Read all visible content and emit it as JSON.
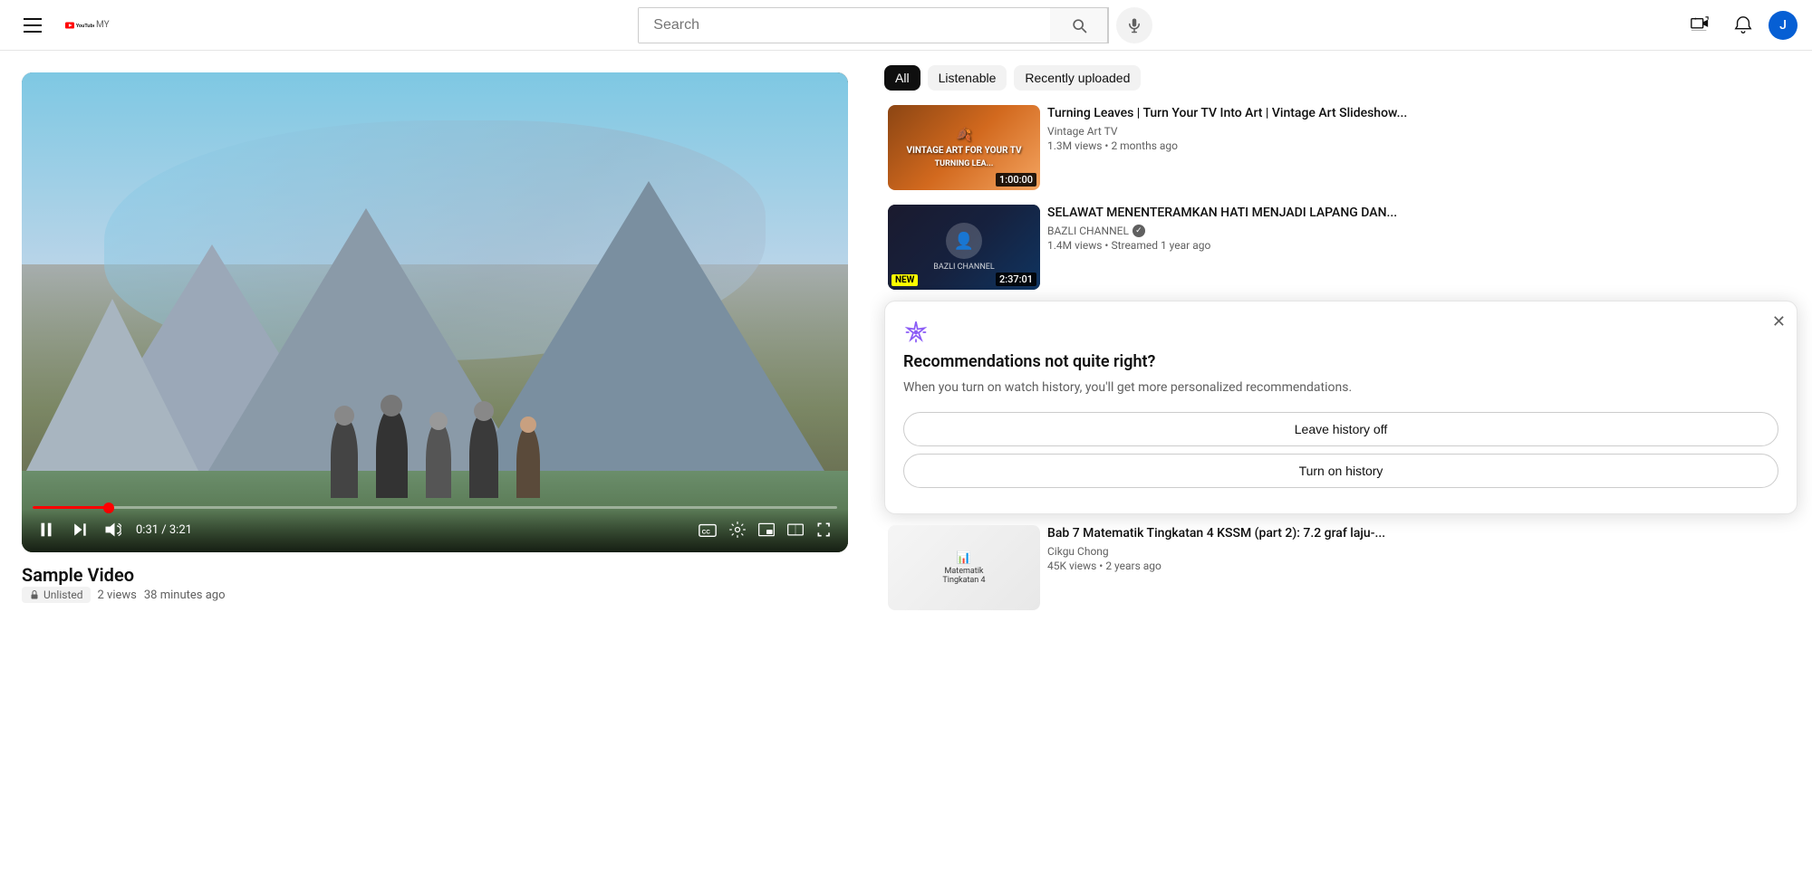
{
  "header": {
    "menu_label": "Menu",
    "logo_text": "YouTube",
    "logo_sup": "MY",
    "search_placeholder": "Search",
    "search_value": "",
    "create_btn_label": "Create",
    "notifications_label": "Notifications",
    "profile_initial": "J"
  },
  "filters": {
    "chips": [
      {
        "id": "all",
        "label": "All",
        "active": true
      },
      {
        "id": "listenable",
        "label": "Listenable",
        "active": false
      },
      {
        "id": "recently-uploaded",
        "label": "Recently uploaded",
        "active": false
      }
    ]
  },
  "video": {
    "title": "Sample Video",
    "visibility": "Unlisted",
    "views": "2 views",
    "time_ago": "38 minutes ago",
    "current_time": "0:31",
    "duration": "3:21",
    "progress_percent": 9.5
  },
  "controls": {
    "play_pause": "pause",
    "next": "next",
    "volume": "volume",
    "time_label": "0:31 / 3:21",
    "cc": "CC",
    "settings": "Settings",
    "miniplayer": "Miniplayer",
    "theater": "Theater mode",
    "fullscreen": "Full screen"
  },
  "recommendations": [
    {
      "title": "Turning Leaves | Turn Your TV Into Art | Vintage Art Slideshow...",
      "channel": "Vintage Art TV",
      "views": "1.3M views",
      "time_ago": "2 months ago",
      "duration": "1:00:00",
      "verified": false,
      "thumb_class": "thumb-vintage",
      "new_badge": false,
      "streamed": false
    },
    {
      "title": "SELAWAT MENENTERAMKAN HATI MENJADI LAPANG DAN...",
      "channel": "BAZLI CHANNEL",
      "views": "1.4M views",
      "time_ago": "Streamed 1 year ago",
      "duration": "2:37:01",
      "verified": true,
      "thumb_class": "thumb-selawat",
      "new_badge": true,
      "streamed": true
    },
    {
      "title": "Bab 7 Matematik Tingkatan 4 KSSM (part 2): 7.2 graf laju-...",
      "channel": "Cikgu Chong",
      "views": "45K views",
      "time_ago": "2 years ago",
      "duration": "",
      "verified": false,
      "thumb_class": "thumb-math",
      "new_badge": false,
      "streamed": false
    }
  ],
  "popup": {
    "title": "Recommendations not quite right?",
    "description": "When you turn on watch history, you'll get more personalized recommendations.",
    "btn_leave_off": "Leave history off",
    "btn_turn_on": "Turn on history",
    "sparkle_icon": "✦"
  }
}
